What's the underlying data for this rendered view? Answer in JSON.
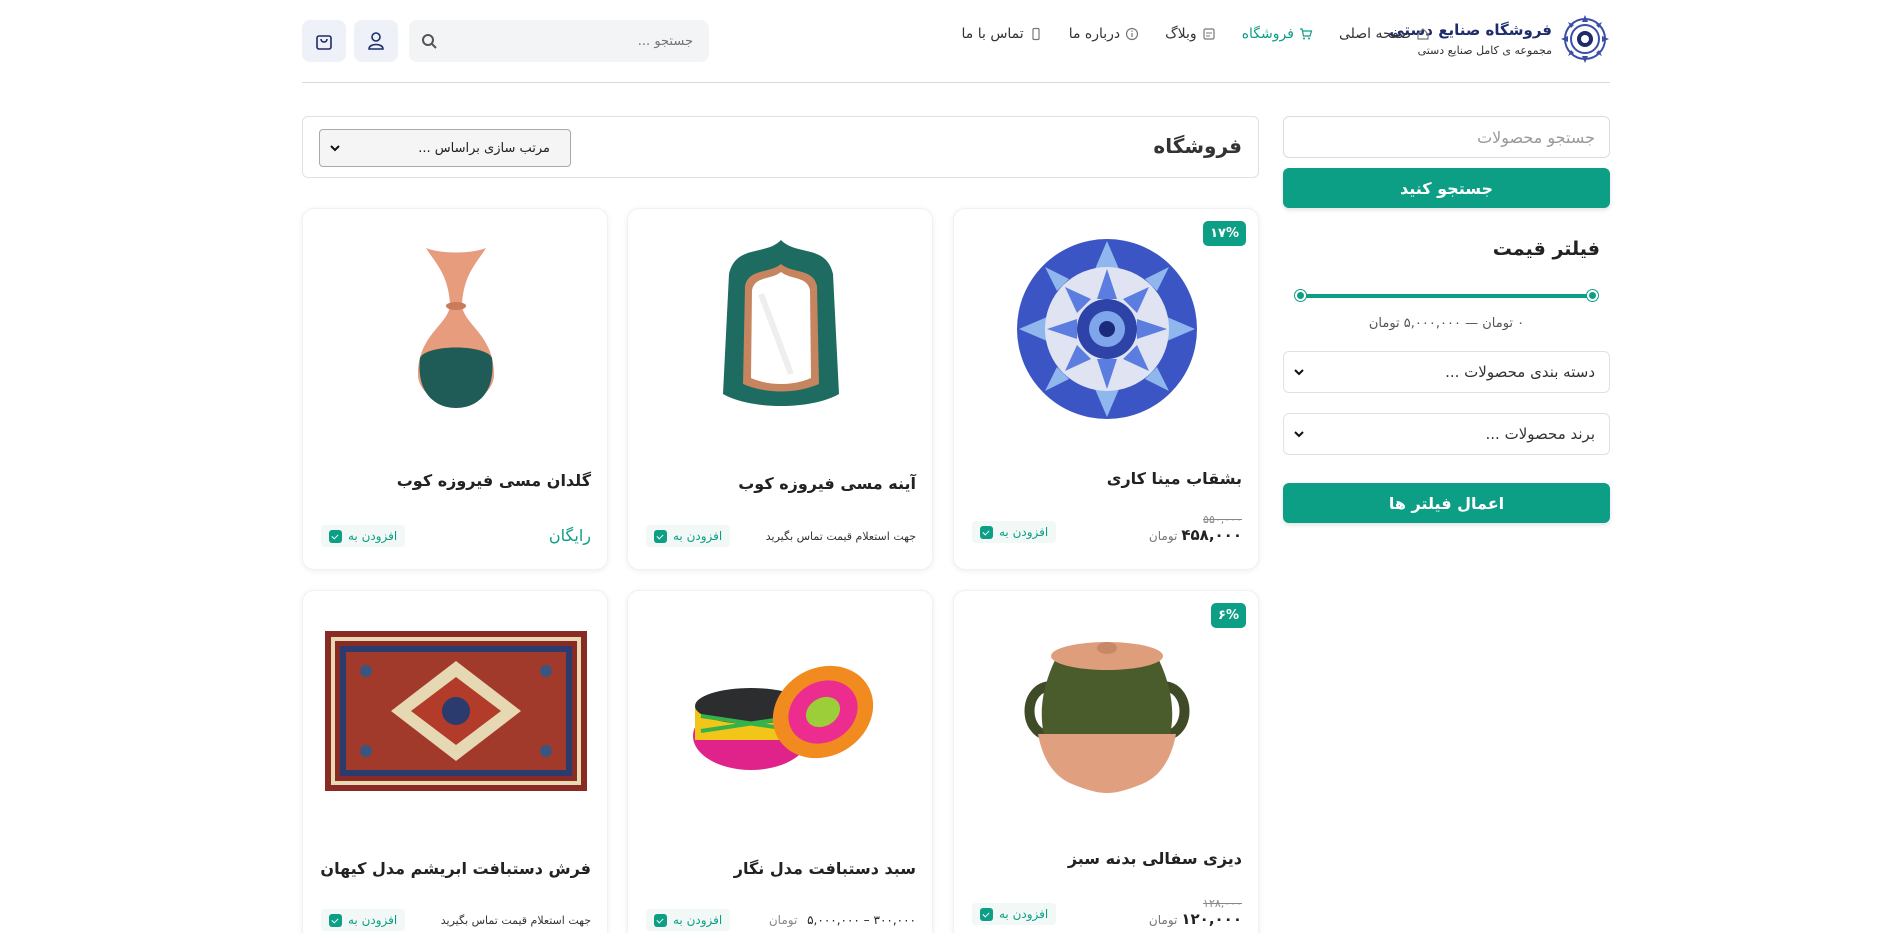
{
  "brand": {
    "title": "فروشگاه صنایع دستی",
    "subtitle": "مجموعه ی کامل صنایع دستی"
  },
  "nav": [
    {
      "label": "صفحه اصلی",
      "icon": "home-icon"
    },
    {
      "label": "فروشگاه",
      "icon": "cart-icon",
      "active": true
    },
    {
      "label": "وبلاگ",
      "icon": "blog-icon"
    },
    {
      "label": "درباره ما",
      "icon": "info-icon"
    },
    {
      "label": "تماس با ما",
      "icon": "phone-icon"
    }
  ],
  "header_search": {
    "placeholder": "جستجو ..."
  },
  "sidebar": {
    "search_placeholder": "جستجو محصولات",
    "search_button": "جستجو کنید",
    "price_filter_title": "فیلتر قیمت",
    "price_range_text": "۰ تومان — ۵,۰۰۰,۰۰۰ تومان",
    "category_select": "دسته بندی محصولات ...",
    "brand_select": "برند محصولات ...",
    "apply_button": "اعمال فیلتر ها"
  },
  "main": {
    "title": "فروشگاه",
    "sort_select": "مرتب سازی براساس ..."
  },
  "products": [
    {
      "name": "بشقاب مینا کاری",
      "badge": "۱۷%",
      "old_price": "۵۵۰,۰۰۰",
      "price": "۴۵۸,۰۰۰",
      "currency": "تومان",
      "add_label": "افزودن به"
    },
    {
      "name": "آینه مسی فیروزه کوب",
      "inquiry": "جهت استعلام قیمت تماس بگیرید",
      "add_label": "افزودن به"
    },
    {
      "name": "گلدان مسی فیروزه کوب",
      "free": "رایگان",
      "add_label": "افزودن به"
    },
    {
      "name": "دیزی سفالی بدنه سبز",
      "badge": "۶%",
      "old_price": "۱۲۸,۰۰۰",
      "price": "۱۲۰,۰۰۰",
      "currency": "تومان",
      "add_label": "افزودن به"
    },
    {
      "name": "سبد دستبافت مدل نگار",
      "price_range": "۳۰۰,۰۰۰  –  ۵,۰۰۰,۰۰۰",
      "currency": "تومان",
      "add_label": "افزودن به"
    },
    {
      "name": "فرش دستبافت ابریشم مدل کیهان",
      "inquiry": "جهت استعلام قیمت تماس بگیرید",
      "add_label": "افزودن به"
    }
  ],
  "colors": {
    "accent": "#0d9e86",
    "brand": "#1d2c6b"
  }
}
